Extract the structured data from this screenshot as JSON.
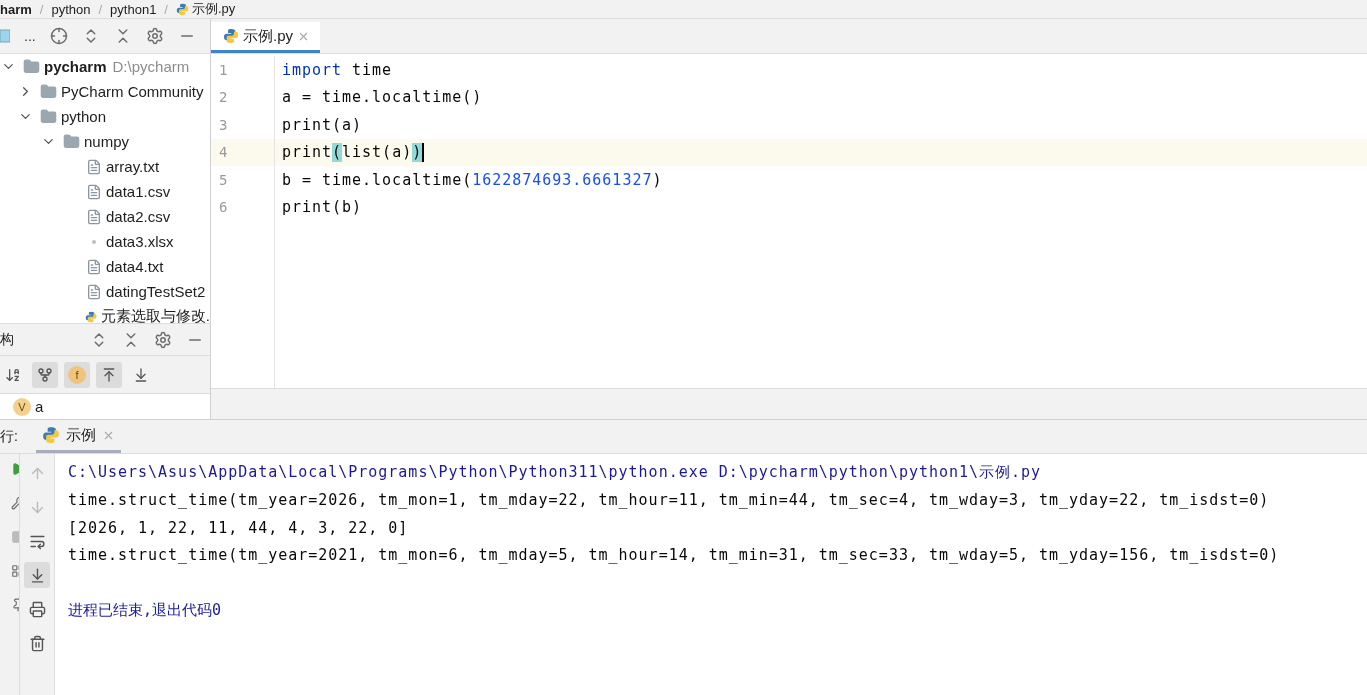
{
  "breadcrumb_separator": "/",
  "breadcrumb": [
    {
      "label": "harm",
      "bold": true,
      "python": false
    },
    {
      "label": "python",
      "bold": false,
      "python": false
    },
    {
      "label": "python1",
      "bold": false,
      "python": false
    },
    {
      "label": "示例.py",
      "bold": false,
      "python": true
    }
  ],
  "project_toolbar": {
    "label": "..."
  },
  "tree": [
    {
      "label": "pycharm",
      "path": "D:\\pycharm",
      "kind": "folder",
      "expanded": true,
      "children": [
        {
          "label": "PyCharm Community",
          "kind": "folder",
          "expanded": false
        },
        {
          "label": "python",
          "kind": "folder",
          "expanded": true,
          "children": [
            {
              "label": "numpy",
              "kind": "folder",
              "expanded": true,
              "children": [
                {
                  "label": "array.txt",
                  "kind": "text"
                },
                {
                  "label": "data1.csv",
                  "kind": "text"
                },
                {
                  "label": "data2.csv",
                  "kind": "text"
                },
                {
                  "label": "data3.xlsx",
                  "kind": "other"
                },
                {
                  "label": "data4.txt",
                  "kind": "text"
                },
                {
                  "label": "datingTestSet2",
                  "kind": "text"
                },
                {
                  "label": "元素选取与修改.",
                  "kind": "python"
                }
              ]
            }
          ]
        }
      ]
    }
  ],
  "structure": {
    "title": "构",
    "tools": [
      {
        "kind": "sort",
        "selected": false
      },
      {
        "kind": "inherited",
        "selected": true
      },
      {
        "kind": "fields",
        "label": "f",
        "selected": true
      },
      {
        "kind": "up",
        "selected": true
      },
      {
        "kind": "down",
        "selected": false
      }
    ],
    "items": [
      {
        "badge": "V",
        "label": "a"
      }
    ]
  },
  "editor": {
    "tabs": [
      {
        "label": "示例.py",
        "selected": true
      }
    ],
    "lines": [
      {
        "number": "1",
        "current": false,
        "tokens": [
          {
            "kind": "keyword",
            "text": "import"
          },
          {
            "kind": "plain",
            "text": " time"
          }
        ]
      },
      {
        "number": "2",
        "current": false,
        "tokens": [
          {
            "kind": "plain",
            "text": "a = time.localtime()"
          }
        ]
      },
      {
        "number": "3",
        "current": false,
        "tokens": [
          {
            "kind": "plain",
            "text": "print(a)"
          }
        ]
      },
      {
        "number": "4",
        "current": true,
        "tokens": [
          {
            "kind": "plain",
            "text": "print"
          },
          {
            "kind": "match",
            "text": "("
          },
          {
            "kind": "plain",
            "text": "list(a)"
          },
          {
            "kind": "match",
            "text": ")"
          }
        ]
      },
      {
        "number": "5",
        "current": false,
        "tokens": [
          {
            "kind": "plain",
            "text": "b = time.localtime("
          },
          {
            "kind": "number",
            "text": "1622874693.6661327"
          },
          {
            "kind": "plain",
            "text": ")"
          }
        ]
      },
      {
        "number": "6",
        "current": false,
        "tokens": [
          {
            "kind": "plain",
            "text": "print(b)"
          }
        ]
      }
    ]
  },
  "run": {
    "label": "行:",
    "tabs": [
      {
        "label": "示例",
        "selected": true
      }
    ],
    "tools": [
      {
        "kind": "up",
        "selected": false
      },
      {
        "kind": "down",
        "selected": false
      },
      {
        "kind": "wrap",
        "selected": false
      },
      {
        "kind": "scroll-end",
        "selected": true
      },
      {
        "kind": "print",
        "selected": false
      },
      {
        "kind": "trash",
        "selected": false
      }
    ],
    "console": [
      {
        "kind": "command",
        "text": "C:\\Users\\Asus\\AppData\\Local\\Programs\\Python\\Python311\\python.exe D:\\pycharm\\python\\python1\\示例.py"
      },
      {
        "kind": "output",
        "text": "time.struct_time(tm_year=2026, tm_mon=1, tm_mday=22, tm_hour=11, tm_min=44, tm_sec=4, tm_wday=3, tm_yday=22, tm_isdst=0)"
      },
      {
        "kind": "output",
        "text": "[2026, 1, 22, 11, 44, 4, 3, 22, 0]"
      },
      {
        "kind": "output",
        "text": "time.struct_time(tm_year=2021, tm_mon=6, tm_mday=5, tm_hour=14, tm_min=31, tm_sec=33, tm_wday=5, tm_yday=156, tm_isdst=0)"
      },
      {
        "kind": "status",
        "text": "进程已结束,退出代码0"
      }
    ]
  }
}
